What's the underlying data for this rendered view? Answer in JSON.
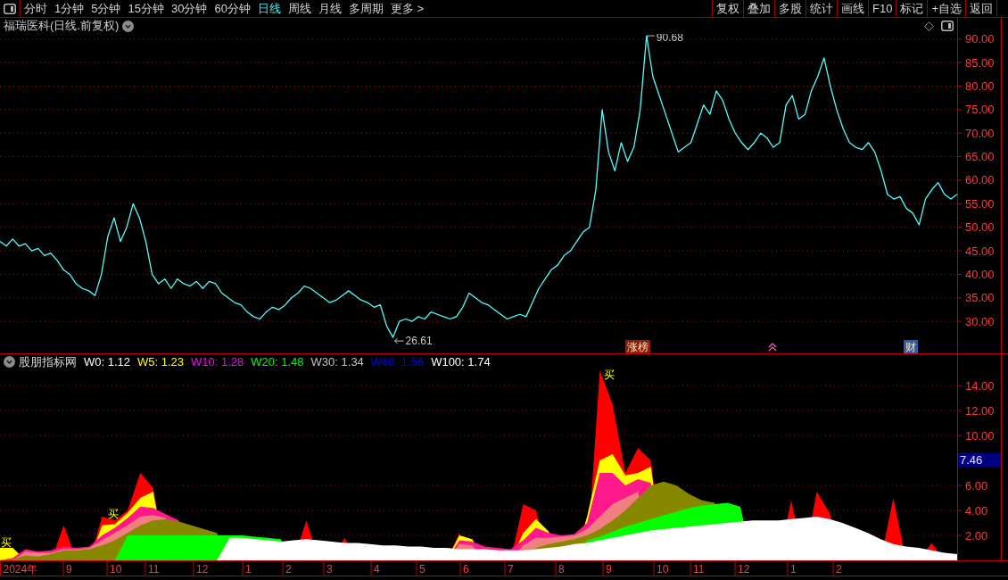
{
  "toolbar": {
    "period_tabs": [
      {
        "label": "分时",
        "selected": false
      },
      {
        "label": "1分钟",
        "selected": false
      },
      {
        "label": "5分钟",
        "selected": false
      },
      {
        "label": "15分钟",
        "selected": false
      },
      {
        "label": "30分钟",
        "selected": false
      },
      {
        "label": "60分钟",
        "selected": false
      },
      {
        "label": "日线",
        "selected": true
      },
      {
        "label": "周线",
        "selected": false
      },
      {
        "label": "月线",
        "selected": false
      },
      {
        "label": "多周期",
        "selected": false
      },
      {
        "label": "更多 >",
        "selected": false
      }
    ],
    "buttons": [
      "复权",
      "叠加",
      "多股",
      "统计",
      "画线",
      "F10",
      "标记",
      "+自选",
      "返回"
    ]
  },
  "price_pane": {
    "title": "福瑞医科(日线.前复权)",
    "high_label": "90.68",
    "low_label": "26.61",
    "events": [
      {
        "kind": "tag",
        "label": "涨榜",
        "color": "#8c1c10"
      },
      {
        "kind": "icon"
      },
      {
        "kind": "tag",
        "label": "财",
        "color": "#2a5cb0"
      }
    ],
    "chart_data": {
      "type": "line",
      "grid": true,
      "ylim": [
        23.2,
        91.1
      ],
      "yticks": [
        {
          "value": 30,
          "label": "30.00"
        },
        {
          "value": 35,
          "label": "35.00"
        },
        {
          "value": 40,
          "label": "40.00"
        },
        {
          "value": 45,
          "label": "45.00"
        },
        {
          "value": 50,
          "label": "50.00"
        },
        {
          "value": 55,
          "label": "55.00"
        },
        {
          "value": 60,
          "label": "60.00"
        },
        {
          "value": 65,
          "label": "65.00"
        },
        {
          "value": 70,
          "label": "70.00"
        },
        {
          "value": 75,
          "label": "75.00"
        },
        {
          "value": 80,
          "label": "80.00"
        },
        {
          "value": 85,
          "label": "85.00"
        },
        {
          "value": 90,
          "label": "90.00"
        }
      ],
      "series": [
        {
          "color": "#54fcfc",
          "values": [
            47,
            46,
            47.5,
            46,
            46.5,
            45,
            45.5,
            44,
            44.5,
            43,
            41,
            40,
            38,
            37,
            36.5,
            35.5,
            40,
            48,
            52,
            47,
            50,
            55,
            52,
            47,
            40,
            38,
            39,
            37,
            39,
            38,
            37.5,
            38.5,
            37,
            38.5,
            38,
            36,
            35,
            34,
            33.5,
            32,
            31,
            30.5,
            32,
            33,
            32.5,
            33.5,
            35,
            36,
            37.5,
            37,
            36,
            35,
            34,
            34.5,
            35.5,
            36.5,
            35.5,
            34.5,
            34,
            33,
            33.5,
            29,
            26.6,
            30,
            30.5,
            30,
            31,
            30.5,
            32,
            31.5,
            31,
            30.5,
            31,
            33,
            36,
            35,
            34,
            33.5,
            32.5,
            31.5,
            30.5,
            31,
            31.5,
            31,
            34,
            37,
            39,
            41,
            42,
            44,
            45,
            47,
            49,
            50,
            58,
            75,
            66,
            62,
            68,
            64,
            67,
            75,
            90.7,
            82,
            78,
            74,
            70,
            66,
            67,
            68,
            72,
            76,
            74,
            79,
            77,
            73,
            70,
            68,
            66.5,
            68,
            70,
            69,
            67,
            68,
            76,
            78,
            73,
            74,
            79,
            82,
            86,
            80,
            75,
            71,
            68,
            67,
            66.5,
            68,
            66,
            62,
            57,
            56,
            56.5,
            54,
            53,
            50.5,
            56,
            58,
            59.5,
            57,
            56,
            57
          ]
        }
      ]
    }
  },
  "indicator_pane": {
    "name": "股朋指标网",
    "legend": [
      {
        "label": "W0: 1.12",
        "color": "#ffffff"
      },
      {
        "label": "W5: 1.23",
        "color": "#ffff00"
      },
      {
        "label": "W10: 1.28",
        "color": "#ff00ff"
      },
      {
        "label": "W20: 1.48",
        "color": "#00ff00"
      },
      {
        "label": "W30: 1.34",
        "color": "#c0c0c0"
      },
      {
        "label": "W60: 1.56",
        "color": "#0000ff"
      },
      {
        "label": "W100: 1.74",
        "color": "#ffffff"
      }
    ],
    "current_value": "7.46",
    "signals": [
      "买",
      "买",
      "买"
    ],
    "chart_data": {
      "type": "area",
      "grid": true,
      "ylim": [
        0,
        15.36
      ],
      "yticks": [
        {
          "value": 2,
          "label": "2.00"
        },
        {
          "value": 4,
          "label": "4.00"
        },
        {
          "value": 6,
          "label": "6.00"
        },
        {
          "value": 10,
          "label": "10.00"
        },
        {
          "value": 12,
          "label": "12.00"
        },
        {
          "value": 14,
          "label": "14.00"
        }
      ],
      "series": [
        {
          "color": "#ff0000",
          "values": [
            0,
            0,
            0,
            0,
            0,
            2.8,
            0,
            0,
            3.5,
            3.2,
            4,
            7,
            5.8,
            0,
            0,
            0,
            0,
            0,
            0,
            0,
            0,
            0,
            0,
            0,
            3.2,
            0,
            0,
            1.8,
            0,
            0,
            0,
            0,
            0,
            0,
            0,
            0,
            2.2,
            0,
            0,
            0,
            0,
            4.5,
            4,
            0,
            0,
            0,
            0,
            15.2,
            12.5,
            7,
            9,
            8,
            0,
            0,
            0,
            0,
            0,
            0,
            0,
            0,
            0,
            0,
            4.8,
            0,
            5.5,
            3.8,
            0,
            0,
            0,
            0,
            5,
            0,
            0,
            1.4,
            0,
            0
          ]
        },
        {
          "color": "#ffff00",
          "values": [
            1,
            1,
            0,
            0,
            0,
            0,
            0,
            0,
            2.8,
            2.9,
            3.8,
            5,
            5.5,
            0,
            0,
            0,
            0,
            0,
            0,
            0,
            0,
            0,
            0,
            0,
            0,
            0,
            0,
            0,
            0,
            0,
            0,
            0,
            0,
            0,
            0,
            0,
            2,
            1.7,
            0,
            0,
            0,
            2.2,
            3.3,
            2.3,
            0,
            0,
            3.5,
            8,
            8.5,
            6.8,
            7,
            7.5,
            0,
            0,
            0,
            0,
            0,
            0,
            0,
            0,
            0,
            0,
            0,
            0,
            0,
            0,
            0,
            0,
            0,
            0,
            0,
            0,
            0,
            0,
            0,
            0
          ]
        },
        {
          "color": "#ff1a8c",
          "values": [
            0,
            0.2,
            0.9,
            0.7,
            0.8,
            1.1,
            1,
            1.1,
            2,
            2.6,
            3.4,
            4.3,
            4.2,
            3.7,
            3.2,
            0,
            0,
            0,
            0,
            0,
            0,
            0,
            0,
            0,
            0,
            0,
            0,
            0,
            0,
            0,
            0,
            0,
            0,
            0,
            0,
            0,
            1.6,
            1.5,
            1.1,
            1,
            0.9,
            1.6,
            2.6,
            2.2,
            2,
            2.1,
            3,
            7,
            7,
            6,
            6.5,
            6.2,
            0,
            0,
            0,
            0,
            0,
            0,
            0,
            0,
            0,
            0,
            0,
            0,
            0,
            0,
            0,
            0,
            0,
            0,
            0,
            0,
            0,
            0,
            0,
            0
          ]
        },
        {
          "color": "#f08080",
          "values": [
            0,
            0,
            0.7,
            0.6,
            0.6,
            0.9,
            0.9,
            1,
            1.6,
            2.2,
            2.8,
            3.5,
            3.6,
            3.4,
            0,
            0,
            0,
            0,
            0,
            0,
            0,
            0,
            0,
            0,
            0,
            0,
            0,
            0,
            0,
            0,
            0,
            0,
            0,
            0,
            0,
            0,
            1.3,
            1.2,
            0,
            0,
            0,
            1.2,
            1.8,
            1.8,
            1.9,
            2,
            2.5,
            3.5,
            4.5,
            5,
            5.5,
            0,
            0,
            0,
            0,
            0,
            0,
            0,
            0,
            0,
            0,
            0,
            0,
            0,
            0,
            0,
            0,
            0,
            0,
            0,
            0,
            0,
            0,
            0,
            0,
            0
          ]
        },
        {
          "color": "#888800",
          "values": [
            0,
            0.1,
            0.4,
            0.3,
            0.5,
            0.8,
            0.8,
            0.9,
            1.2,
            1.6,
            2.2,
            2.8,
            3.2,
            3.3,
            3.1,
            2.8,
            2.5,
            2.2,
            0,
            0,
            0,
            0,
            0,
            0,
            0,
            0,
            0,
            0,
            0,
            0,
            0,
            0,
            0,
            0,
            0,
            0,
            0,
            0,
            0,
            0,
            0,
            0,
            1,
            1.3,
            1.5,
            1.7,
            2,
            2.5,
            3.2,
            4,
            5,
            6,
            6.3,
            6,
            5.3,
            4.8,
            4.6,
            0,
            0,
            0,
            0,
            0,
            0,
            0,
            0,
            0,
            0,
            0,
            0,
            0,
            0,
            0,
            0,
            0,
            0,
            0
          ]
        },
        {
          "color": "#00ff00",
          "values": [
            0,
            0,
            0,
            0,
            0,
            0,
            0,
            0,
            0,
            0,
            2,
            2,
            2,
            2,
            2,
            2,
            2,
            2,
            2,
            2,
            1.9,
            1.8,
            1.7,
            0,
            0,
            0,
            0,
            0,
            0,
            0,
            0,
            0,
            0,
            0,
            0,
            0,
            0,
            0,
            0,
            0,
            0,
            0,
            0,
            0,
            0,
            0,
            1.6,
            1.9,
            2.3,
            2.7,
            3,
            3.3,
            3.6,
            3.9,
            4.2,
            4.4,
            4.5,
            4.6,
            4.3,
            0,
            0,
            0,
            0,
            0,
            0,
            0,
            0,
            0,
            0,
            0,
            0,
            0,
            0,
            0,
            0,
            0
          ]
        },
        {
          "color": "#ffffff",
          "values": [
            0,
            0,
            0,
            0,
            0,
            0,
            0,
            0,
            0,
            0,
            0,
            0,
            0,
            0,
            0,
            0,
            0,
            0,
            1.8,
            1.8,
            1.7,
            1.6,
            1.5,
            1.6,
            1.7,
            1.6,
            1.5,
            1.4,
            1.4,
            1.3,
            1.2,
            1.2,
            1.1,
            1.1,
            1,
            1,
            0.9,
            0.9,
            0.9,
            0.8,
            0.8,
            0.8,
            0.9,
            1,
            1.1,
            1.3,
            1.4,
            1.6,
            1.8,
            2,
            2.2,
            2.4,
            2.5,
            2.6,
            2.7,
            2.8,
            2.9,
            3,
            3.1,
            3.2,
            3.2,
            3.2,
            3.3,
            3.4,
            3.5,
            3.3,
            3,
            2.6,
            2.2,
            1.7,
            1.3,
            1.1,
            1,
            0.8,
            0.6,
            0.5
          ]
        }
      ]
    }
  },
  "time_axis": [
    "2024年",
    "9",
    "10",
    "11",
    "12",
    "1",
    "2",
    "3",
    "4",
    "5",
    "6",
    "7",
    "8",
    "9",
    "10",
    "11",
    "12",
    "1",
    "2"
  ]
}
